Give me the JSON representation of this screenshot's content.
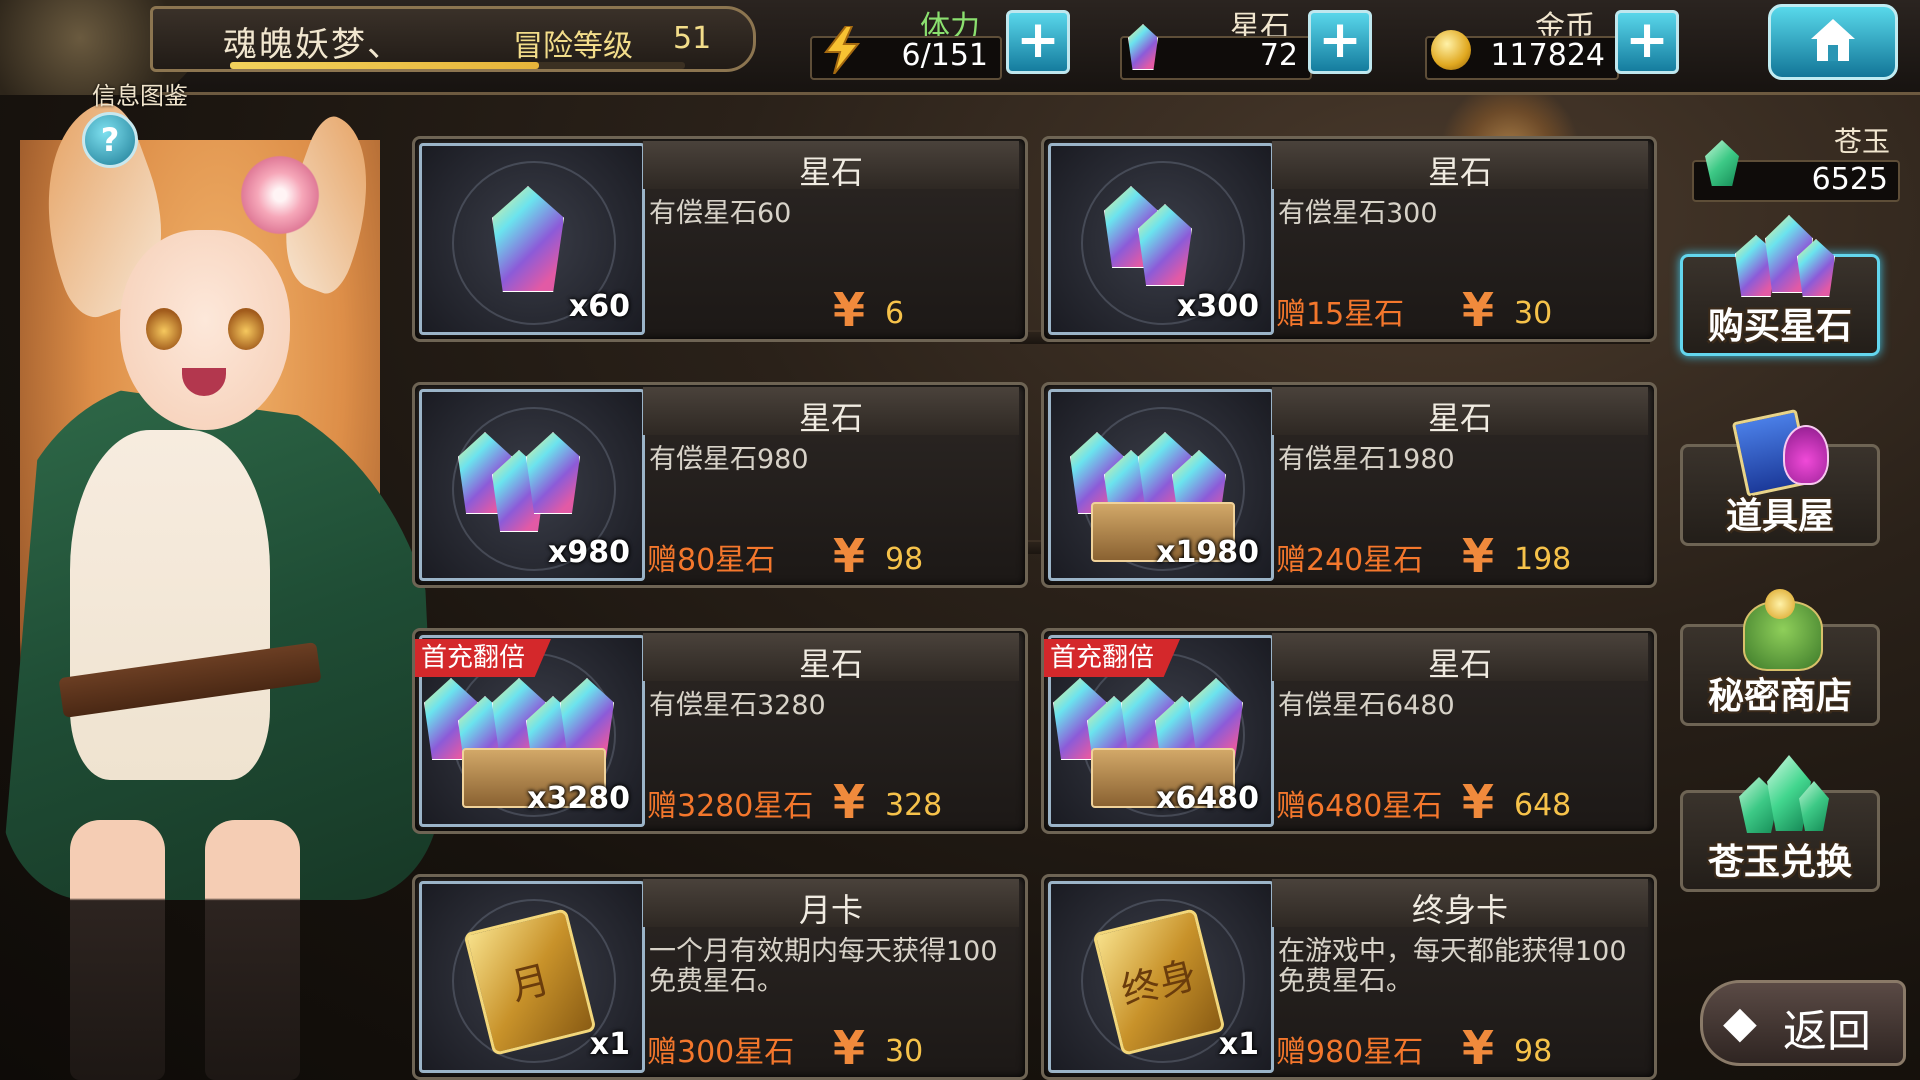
{
  "player": {
    "name": "魂魄妖梦、",
    "adventure_label": "冒险等级",
    "adventure_level": "51",
    "info_label": "信息图鉴",
    "help_icon": "?"
  },
  "resources": {
    "stamina": {
      "label": "体力",
      "value": "6/151",
      "icon": "lightning-icon"
    },
    "star_stone": {
      "label": "星石",
      "value": "72",
      "icon": "crystal-icon"
    },
    "gold": {
      "label": "金币",
      "value": "117824",
      "icon": "coin-icon"
    }
  },
  "jade": {
    "label": "苍玉",
    "value": "6525"
  },
  "shop": {
    "yen_symbol": "¥",
    "items": [
      {
        "title": "星石",
        "desc": "有偿星石60",
        "qty": "x60",
        "bonus": "",
        "price": "6",
        "ribbon": ""
      },
      {
        "title": "星石",
        "desc": "有偿星石300",
        "qty": "x300",
        "bonus": "赠15星石",
        "price": "30",
        "ribbon": ""
      },
      {
        "title": "星石",
        "desc": "有偿星石980",
        "qty": "x980",
        "bonus": "赠80星石",
        "price": "98",
        "ribbon": ""
      },
      {
        "title": "星石",
        "desc": "有偿星石1980",
        "qty": "x1980",
        "bonus": "赠240星石",
        "price": "198",
        "ribbon": ""
      },
      {
        "title": "星石",
        "desc": "有偿星石3280",
        "qty": "x3280",
        "bonus": "赠3280星石",
        "price": "328",
        "ribbon": "首充翻倍"
      },
      {
        "title": "星石",
        "desc": "有偿星石6480",
        "qty": "x6480",
        "bonus": "赠6480星石",
        "price": "648",
        "ribbon": "首充翻倍"
      },
      {
        "title": "月卡",
        "desc": "一个月有效期内每天获得100免费星石。",
        "qty": "x1",
        "bonus": "赠300星石",
        "price": "30",
        "ribbon": "",
        "card_char": "月"
      },
      {
        "title": "终身卡",
        "desc": "在游戏中，每天都能获得100免费星石。",
        "qty": "x1",
        "bonus": "赠980星石",
        "price": "98",
        "ribbon": "",
        "card_char": "终身"
      }
    ]
  },
  "nav": {
    "buy_star_stone": "购买星石",
    "item_shop": "道具屋",
    "secret_shop": "秘密商店",
    "jade_exchange": "苍玉兑换",
    "back": "返回"
  }
}
